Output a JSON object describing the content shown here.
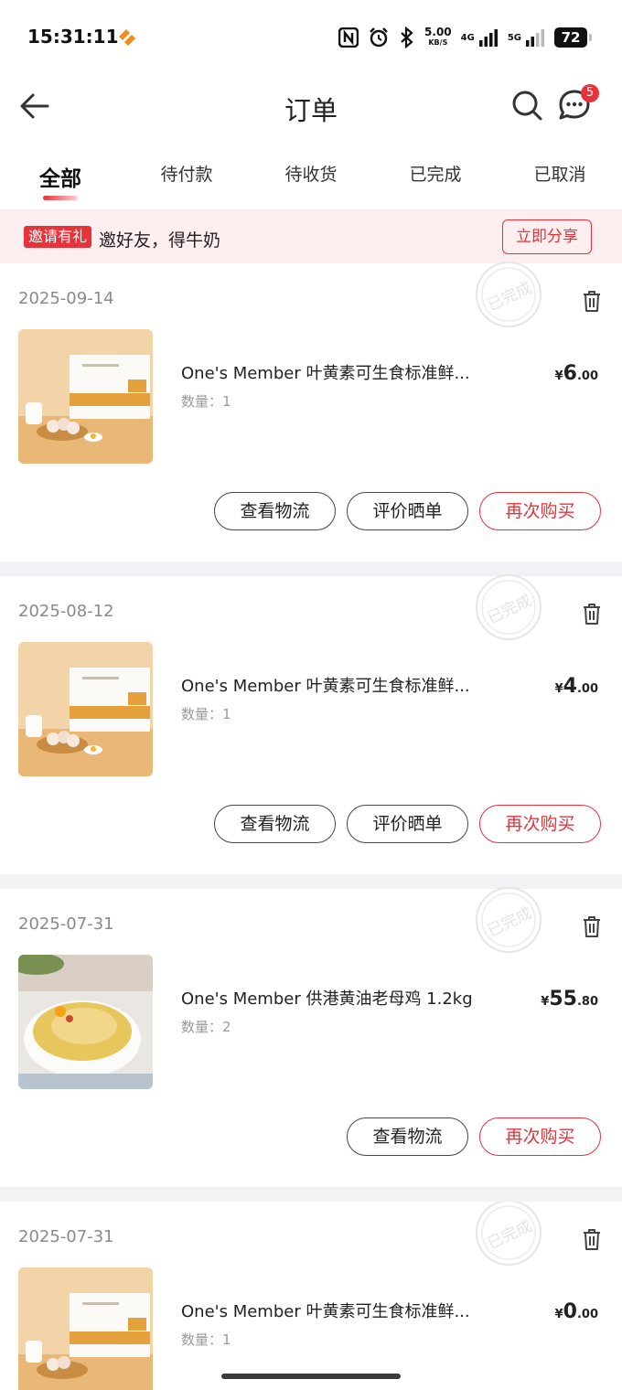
{
  "status_bar": {
    "time": "15:31:11",
    "net_speed": "5.00",
    "net_speed_unit": "KB/S",
    "net_4g": "4G",
    "net_5g": "5G",
    "battery": "72"
  },
  "header": {
    "title": "订单",
    "message_badge": "5"
  },
  "tabs": [
    {
      "label": "全部",
      "active": true
    },
    {
      "label": "待付款",
      "active": false
    },
    {
      "label": "待收货",
      "active": false
    },
    {
      "label": "已完成",
      "active": false
    },
    {
      "label": "已取消",
      "active": false
    }
  ],
  "banner": {
    "tag": "邀请有礼",
    "text": "邀好友，得牛奶",
    "button": "立即分享"
  },
  "orders": [
    {
      "date": "2025-09-14",
      "name": "One's Member 叶黄素可生食标准鲜...",
      "qty_label": "数量：1",
      "price_currency": "¥",
      "price_int": "6",
      "price_dec": ".00",
      "buttons": [
        "查看物流",
        "评价晒单",
        "再次购买"
      ]
    },
    {
      "date": "2025-08-12",
      "name": "One's Member 叶黄素可生食标准鲜...",
      "qty_label": "数量：1",
      "price_currency": "¥",
      "price_int": "4",
      "price_dec": ".00",
      "buttons": [
        "查看物流",
        "评价晒单",
        "再次购买"
      ]
    },
    {
      "date": "2025-07-31",
      "name": "One's Member 供港黄油老母鸡 1.2kg",
      "qty_label": "数量：2",
      "price_currency": "¥",
      "price_int": "55",
      "price_dec": ".80",
      "buttons": [
        "查看物流",
        "再次购买"
      ]
    },
    {
      "date": "2025-07-31",
      "name": "One's Member 叶黄素可生食标准鲜...",
      "qty_label": "数量：1",
      "price_currency": "¥",
      "price_int": "0",
      "price_dec": ".00",
      "buttons": []
    }
  ],
  "stamp_text": "已完成",
  "colors": {
    "accent": "#e8323a",
    "banner_bg": "#fdeef0",
    "page_bg": "#f2f2f4"
  }
}
